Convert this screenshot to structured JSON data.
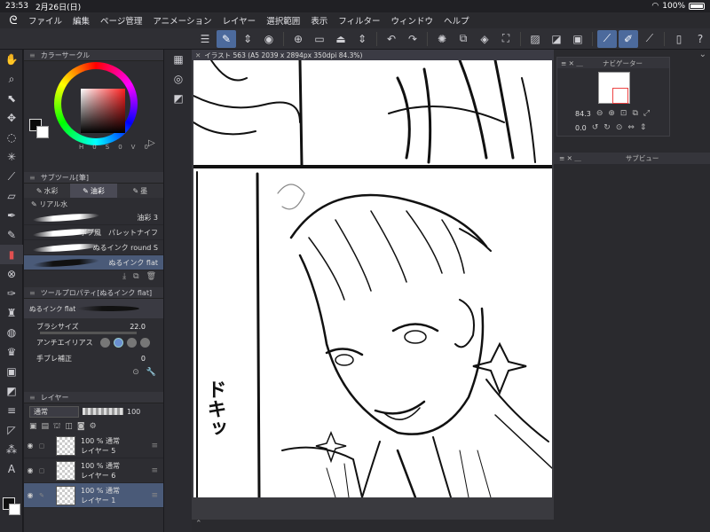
{
  "status": {
    "time": "23:53",
    "date": "2月26日(日)",
    "battery": "100%"
  },
  "menu": [
    "ファイル",
    "編集",
    "ページ管理",
    "アニメーション",
    "レイヤー",
    "選択範囲",
    "表示",
    "フィルター",
    "ウィンドウ",
    "ヘルプ"
  ],
  "color_circle": {
    "title": "カラーサークル",
    "values": [
      "H",
      "0",
      "S",
      "0",
      "V",
      "0"
    ],
    "fg_color": "#0a0a0a",
    "bg_color": "#ffffff"
  },
  "subtool": {
    "title": "サブツール[筆]",
    "tabs": [
      "水彩",
      "油彩",
      "墨"
    ],
    "active_tab": 1,
    "group": "リアル水",
    "brushes": [
      "油彩 3",
      "ボブ風　パレットナイフ",
      "ぬるインク round S",
      "ぬるインク flat"
    ],
    "selected_brush": 3
  },
  "toolprop": {
    "title": "ツールプロパティ[ぬるインク flat]",
    "preview_label": "ぬるインク flat",
    "brush_size_label": "ブラシサイズ",
    "brush_size": "22.0",
    "antialias_label": "アンチエイリアス",
    "stabilization_label": "手ブレ補正",
    "stabilization": "0"
  },
  "layer": {
    "title": "レイヤー",
    "blend_mode": "通常",
    "opacity": "100",
    "layers": [
      {
        "opacity": "100 %",
        "mode": "通常",
        "name": "レイヤー 5"
      },
      {
        "opacity": "100 %",
        "mode": "通常",
        "name": "レイヤー 6"
      },
      {
        "opacity": "100 %",
        "mode": "通常",
        "name": "レイヤー 1"
      }
    ]
  },
  "canvas": {
    "tab_title": "イラスト 563 (A5 2039 x 2894px 350dpi 84.3%)",
    "sfx": "ドキッ"
  },
  "navigator": {
    "title": "ナビゲーター",
    "zoom": "84.3",
    "rotate": "0.0"
  },
  "subview": {
    "title": "サブビュー"
  },
  "colors": {
    "accent": "#4c6a9c",
    "selected_row": "#4a5a78",
    "panel_bg": "#2d2d32"
  }
}
